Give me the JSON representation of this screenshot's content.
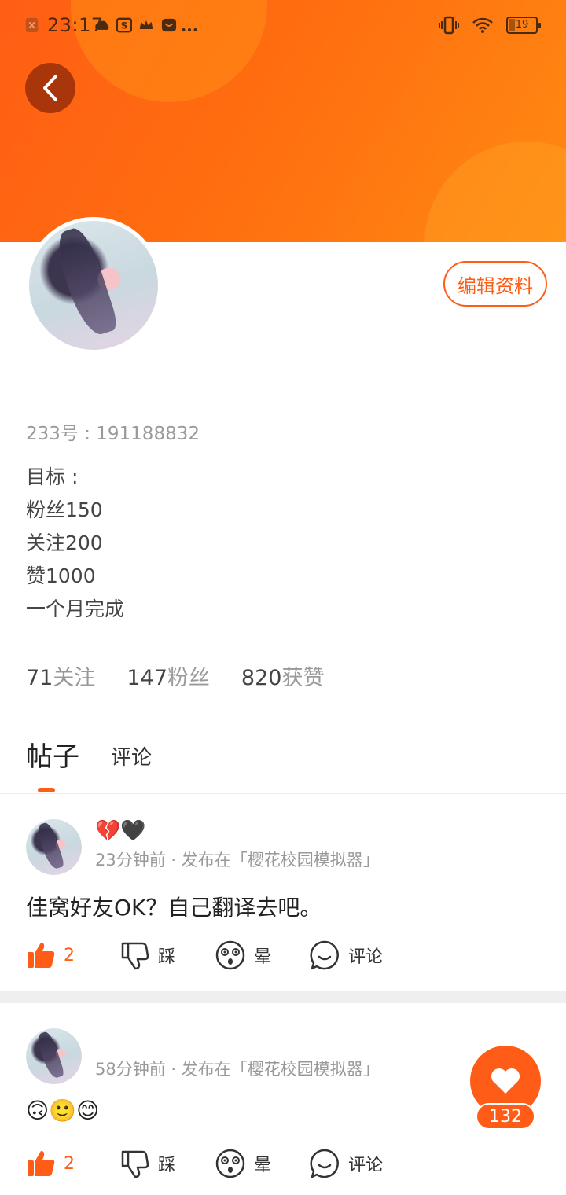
{
  "status_bar": {
    "time": "23:17",
    "battery": "19",
    "icons": [
      "sim-icon",
      "cloud-icon",
      "s-app-icon",
      "crown-icon",
      "app-icon",
      "more-dots-icon",
      "vibrate-icon",
      "wifi-icon",
      "battery-icon"
    ]
  },
  "header": {
    "back_icon": "chevron-left-icon",
    "gradient_colors": [
      "#ff5e14",
      "#ff8a12"
    ]
  },
  "profile": {
    "edit_label": "编辑资料",
    "uid": "233号 : 191188832",
    "bio_lines": [
      "目标 :",
      "粉丝150",
      "关注200",
      "赞1000",
      "一个月完成"
    ],
    "stats": [
      {
        "num": "71",
        "label": "关注"
      },
      {
        "num": "147",
        "label": "粉丝"
      },
      {
        "num": "820",
        "label": "获赞"
      }
    ]
  },
  "tabs": {
    "active": "帖子",
    "other": "评论"
  },
  "posts": [
    {
      "top_emoji": "💔🖤",
      "meta": "23分钟前 · 发布在「樱花校园模拟器」",
      "text": "佳窝好友OK？自己翻译去吧。",
      "likes": "2",
      "dislike_label": "踩",
      "dizzy_label": "晕",
      "comment_label": "评论"
    },
    {
      "meta": "58分钟前 · 发布在「樱花校园模拟器」",
      "text": "🙃🙂😊",
      "likes": "2",
      "dislike_label": "踩",
      "dizzy_label": "晕",
      "comment_label": "评论"
    }
  ],
  "fab": {
    "icon": "heart-icon",
    "count": "132"
  },
  "colors": {
    "accent": "#ff5d17",
    "secondary_text": "#999999"
  }
}
